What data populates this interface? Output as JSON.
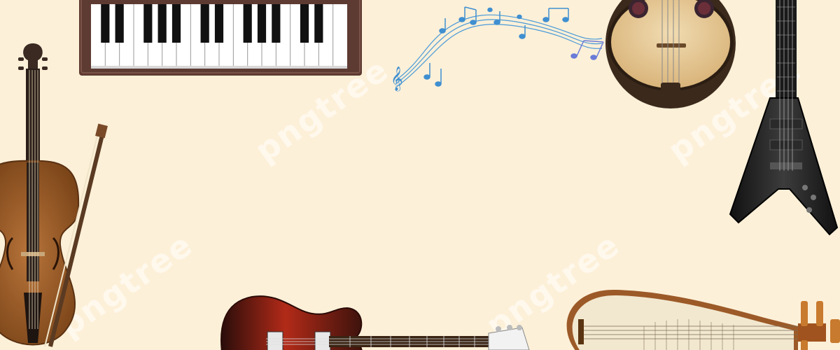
{
  "scene": {
    "background_color": "#fdf0d8",
    "instruments": [
      {
        "name": "piano-keyboard-icon"
      },
      {
        "name": "music-notes-icon"
      },
      {
        "name": "ruan-lute-icon"
      },
      {
        "name": "electric-flying-v-guitar-icon"
      },
      {
        "name": "violin-with-bow-icon"
      },
      {
        "name": "electric-guitar-icon"
      },
      {
        "name": "pipa-lute-icon"
      }
    ]
  },
  "watermark": {
    "text": "pngtree"
  },
  "colors": {
    "piano_frame": "#5e3b32",
    "violin_wood": "#a0602c",
    "ruan_wood": "#e8c995",
    "flying_v": "#222222",
    "electric_guitar_body": "#9b1f14",
    "pipa_body": "#f2e8d0",
    "notes_blue": "#4a9bd8"
  }
}
